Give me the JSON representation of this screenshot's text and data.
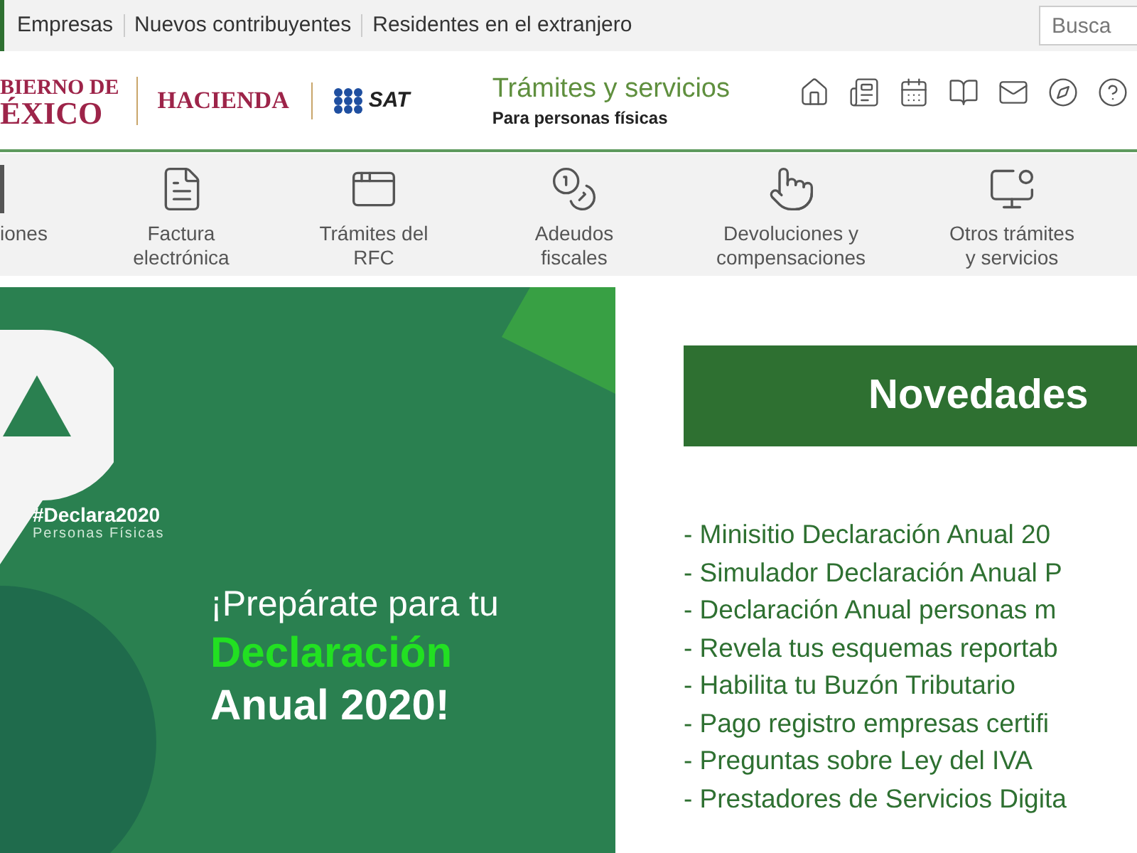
{
  "top_bar": {
    "links": [
      "Empresas",
      "Nuevos contribuyentes",
      "Residentes en el extranjero"
    ],
    "search": {
      "placeholder": "Busca"
    }
  },
  "header": {
    "logos": {
      "gobierno": [
        "BIERNO DE",
        "ÉXICO"
      ],
      "hacienda": "HACIENDA",
      "sat": "SAT"
    },
    "title": "Trámites y servicios",
    "subtitle": "Para personas físicas"
  },
  "nav": [
    {
      "label": [
        "iones"
      ]
    },
    {
      "label": [
        "Factura",
        "electrónica"
      ]
    },
    {
      "label": [
        "Trámites del",
        "RFC"
      ]
    },
    {
      "label": [
        "Adeudos",
        "fiscales"
      ]
    },
    {
      "label": [
        "Devoluciones y",
        "compensaciones"
      ]
    },
    {
      "label": [
        "Otros trámites",
        "y servicios"
      ]
    }
  ],
  "banner": {
    "hashtag": "#Declara2020",
    "hashtag_sub": "Personas Físicas",
    "line1": "¡Prepárate para tu",
    "line2": "Declaración",
    "line3": "Anual 2020!"
  },
  "news": {
    "title": "Novedades",
    "items": [
      "- Minisitio Declaración Anual 20",
      "- Simulador Declaración Anual P",
      "- Declaración Anual personas m",
      "- Revela tus esquemas reportab",
      "- Habilita tu Buzón Tributario",
      "- Pago registro empresas certifi",
      "- Preguntas sobre Ley del IVA",
      "- Prestadores de Servicios Digita"
    ]
  }
}
